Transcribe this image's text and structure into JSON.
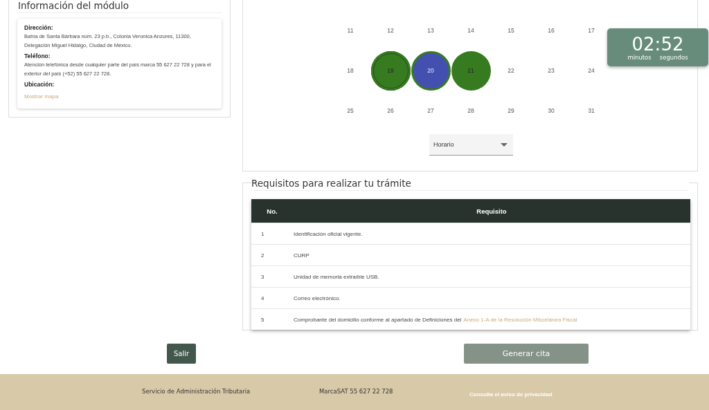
{
  "module_info": {
    "title": "Información del módulo",
    "sections": [
      {
        "label": "Dirección:",
        "text": "Bahía de Santa Bárbara núm. 23 p.b., Colonia Veronica Anzures, 11300, Delegación Miguel Hidalgo, Ciudad de México.",
        "kind": "text"
      },
      {
        "label": "Teléfono:",
        "text": "Atención telefónica desde cualquier parte del país marca 55 627 22 728 y para el exterior del país (+52) 55 627 22 728.",
        "kind": "text"
      },
      {
        "label": "Ubicación:",
        "text": "Mostrar mapa",
        "kind": "link"
      }
    ]
  },
  "calendar": {
    "days": [
      {
        "label": "11",
        "available": false,
        "selected": false,
        "today": false
      },
      {
        "label": "12",
        "available": false,
        "selected": false,
        "today": false
      },
      {
        "label": "13",
        "available": false,
        "selected": false,
        "today": false
      },
      {
        "label": "14",
        "available": false,
        "selected": false,
        "today": false
      },
      {
        "label": "15",
        "available": false,
        "selected": false,
        "today": false
      },
      {
        "label": "16",
        "available": false,
        "selected": false,
        "today": false
      },
      {
        "label": "17",
        "available": false,
        "selected": false,
        "today": false
      },
      {
        "label": "18",
        "available": false,
        "selected": false,
        "today": false
      },
      {
        "label": "19",
        "available": true,
        "selected": false,
        "today": true
      },
      {
        "label": "20",
        "available": true,
        "selected": true,
        "today": false
      },
      {
        "label": "21",
        "available": true,
        "selected": false,
        "today": false
      },
      {
        "label": "22",
        "available": false,
        "selected": false,
        "today": false
      },
      {
        "label": "23",
        "available": false,
        "selected": false,
        "today": false
      },
      {
        "label": "24",
        "available": false,
        "selected": false,
        "today": false
      },
      {
        "label": "25",
        "available": false,
        "selected": false,
        "today": false
      },
      {
        "label": "26",
        "available": false,
        "selected": false,
        "today": false
      },
      {
        "label": "27",
        "available": false,
        "selected": false,
        "today": false
      },
      {
        "label": "28",
        "available": false,
        "selected": false,
        "today": false
      },
      {
        "label": "29",
        "available": false,
        "selected": false,
        "today": false
      },
      {
        "label": "30",
        "available": false,
        "selected": false,
        "today": false
      },
      {
        "label": "31",
        "available": false,
        "selected": false,
        "today": false
      }
    ],
    "schedule_select": {
      "placeholder": "Horario"
    }
  },
  "timer": {
    "time": "02:52",
    "minutes_label": "minutos",
    "seconds_label": "segundos"
  },
  "requirements": {
    "title": "Requisitos para realizar tu trámite",
    "columns": [
      "No.",
      "Requisito"
    ],
    "rows": [
      {
        "no": "1",
        "text": "Identificación oficial vigente."
      },
      {
        "no": "2",
        "text": "CURP"
      },
      {
        "no": "3",
        "text": "Unidad de memoria extraíble USB."
      },
      {
        "no": "4",
        "text": "Correo electrónico."
      },
      {
        "no": "5",
        "text": "Comprobante del domicilio conforme al apartado de Definiciones del",
        "link": "Anexo 1-A de la Resolución Miscelánea Fiscal"
      }
    ]
  },
  "buttons": {
    "exit": {
      "label": "Salir",
      "disabled": false
    },
    "submit": {
      "label": "Generar cita",
      "disabled": true
    }
  },
  "footer": {
    "org": "Servicio de Administración Tributaria",
    "phone": "MarcaSAT 55 627 22 728",
    "privacy": "Consulta el aviso de privacidad"
  }
}
